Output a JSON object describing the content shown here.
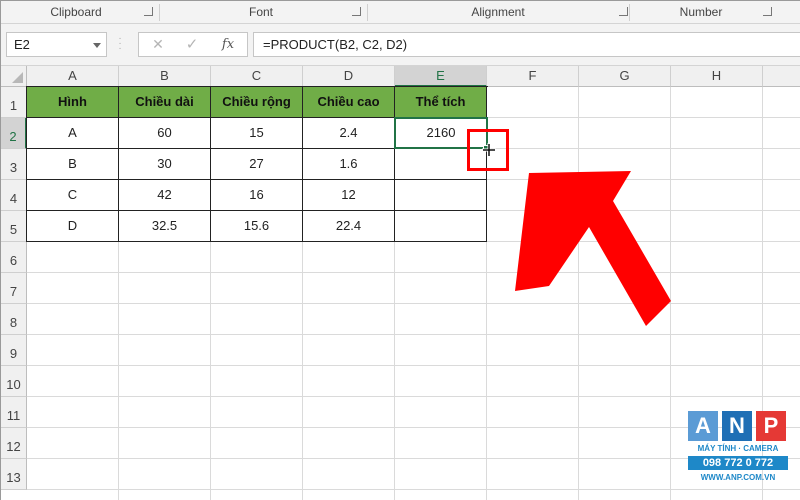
{
  "ribbon": {
    "groups": [
      {
        "label": "Clipboard"
      },
      {
        "label": "Font"
      },
      {
        "label": "Alignment"
      },
      {
        "label": "Number"
      }
    ]
  },
  "formula_bar": {
    "name_box": "E2",
    "cancel_glyph": "✕",
    "enter_glyph": "✓",
    "fx_label": "fx",
    "formula": "=PRODUCT(B2, C2, D2)"
  },
  "sheet": {
    "columns": [
      "A",
      "B",
      "C",
      "D",
      "E",
      "F",
      "G",
      "H"
    ],
    "rows": [
      "1",
      "2",
      "3",
      "4",
      "5",
      "6",
      "7",
      "8",
      "9",
      "10",
      "11",
      "12",
      "13"
    ],
    "selected_cell": "E2",
    "table_header": [
      "Hình",
      "Chiều dài",
      "Chiều rộng",
      "Chiều cao",
      "Thể tích"
    ],
    "table_rows": [
      [
        "A",
        "60",
        "15",
        "2.4",
        "2160"
      ],
      [
        "B",
        "30",
        "27",
        "1.6",
        ""
      ],
      [
        "C",
        "42",
        "16",
        "12",
        ""
      ],
      [
        "D",
        "32.5",
        "15.6",
        "22.4",
        ""
      ]
    ],
    "header_fill_color": "#70ad47",
    "selection_color": "#217346"
  },
  "annotation": {
    "highlight_color": "#ff0000",
    "pointer": "fill-handle-cursor"
  },
  "watermark": {
    "letters": [
      "A",
      "N",
      "P"
    ],
    "letter_colors": [
      "#5b9bd5",
      "#1f6fb5",
      "#e53935"
    ],
    "tagline": "MÁY TÍNH · CAMERA",
    "phone": "098 772 0 772",
    "site": "WWW.ANP.COM.VN"
  }
}
